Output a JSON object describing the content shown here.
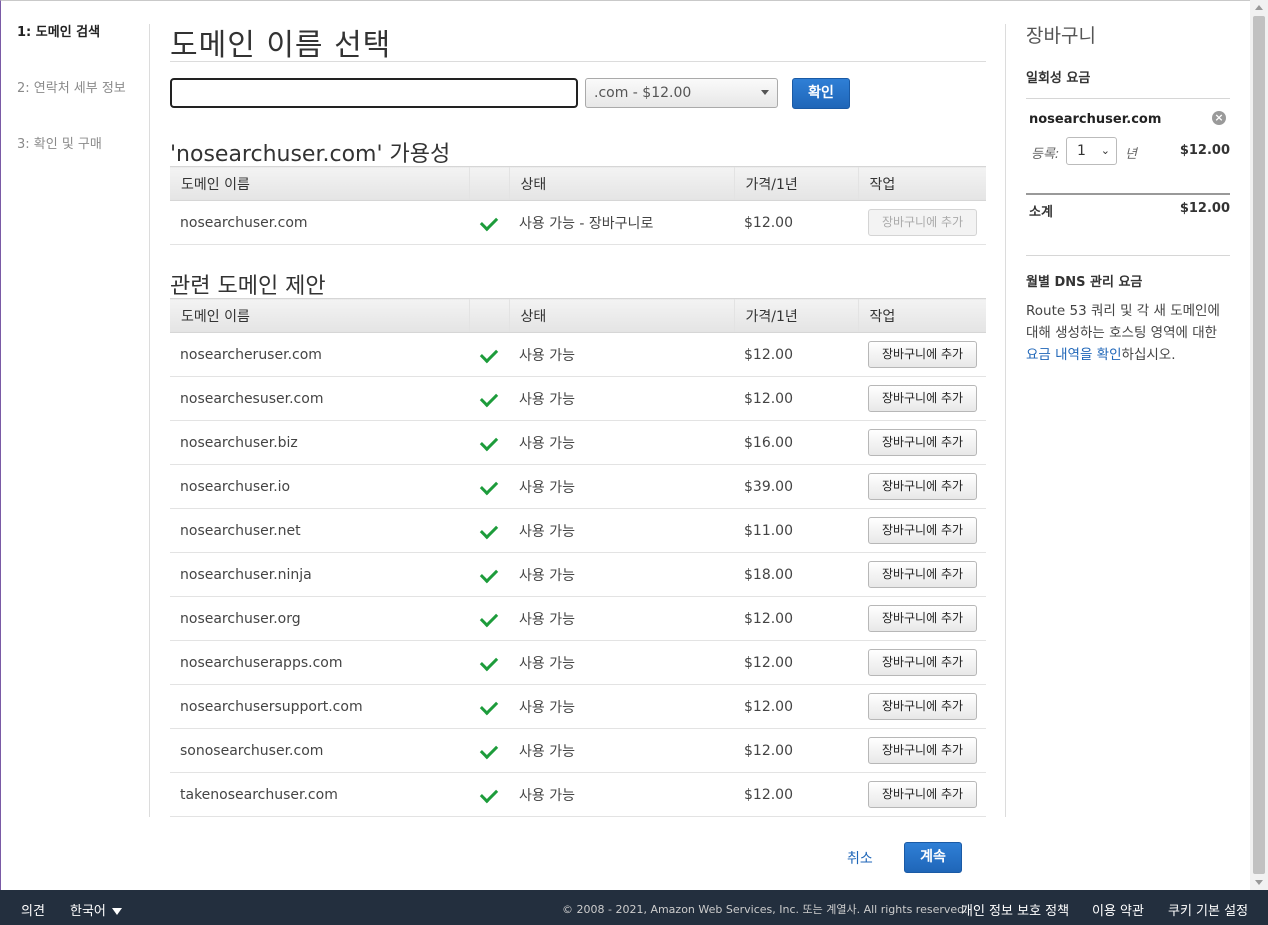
{
  "steps": [
    {
      "label": "1: 도메인 검색"
    },
    {
      "label": "2: 연락처 세부 정보"
    },
    {
      "label": "3: 확인 및 구매"
    }
  ],
  "main": {
    "title": "도메인 이름 선택",
    "search": {
      "value": "",
      "placeholder": ""
    },
    "tld_selected": ".com - $12.00",
    "confirm_label": "확인",
    "availability_title": "'nosearchuser.com' 가용성",
    "related_title": "관련 도메인 제안",
    "columns": [
      "도메인 이름",
      "",
      "상태",
      "가격/1년",
      "작업"
    ],
    "availability_row": {
      "domain": "nosearchuser.com",
      "status": "사용 가능 - 장바구니로",
      "price": "$12.00",
      "action": "장바구니에 추가"
    },
    "related_rows": [
      {
        "domain": "nosearcheruser.com",
        "status": "사용 가능",
        "price": "$12.00",
        "action": "장바구니에 추가"
      },
      {
        "domain": "nosearchesuser.com",
        "status": "사용 가능",
        "price": "$12.00",
        "action": "장바구니에 추가"
      },
      {
        "domain": "nosearchuser.biz",
        "status": "사용 가능",
        "price": "$16.00",
        "action": "장바구니에 추가"
      },
      {
        "domain": "nosearchuser.io",
        "status": "사용 가능",
        "price": "$39.00",
        "action": "장바구니에 추가"
      },
      {
        "domain": "nosearchuser.net",
        "status": "사용 가능",
        "price": "$11.00",
        "action": "장바구니에 추가"
      },
      {
        "domain": "nosearchuser.ninja",
        "status": "사용 가능",
        "price": "$18.00",
        "action": "장바구니에 추가"
      },
      {
        "domain": "nosearchuser.org",
        "status": "사용 가능",
        "price": "$12.00",
        "action": "장바구니에 추가"
      },
      {
        "domain": "nosearchuserapps.com",
        "status": "사용 가능",
        "price": "$12.00",
        "action": "장바구니에 추가"
      },
      {
        "domain": "nosearchusersupport.com",
        "status": "사용 가능",
        "price": "$12.00",
        "action": "장바구니에 추가"
      },
      {
        "domain": "sonosearchuser.com",
        "status": "사용 가능",
        "price": "$12.00",
        "action": "장바구니에 추가"
      },
      {
        "domain": "takenosearchuser.com",
        "status": "사용 가능",
        "price": "$12.00",
        "action": "장바구니에 추가"
      }
    ],
    "cancel_label": "취소",
    "continue_label": "계속"
  },
  "cart": {
    "title": "장바구니",
    "one_time_label": "일회성 요금",
    "item_domain": "nosearchuser.com",
    "register_label": "등록:",
    "years_value": "1",
    "year_unit": "년",
    "item_price": "$12.00",
    "subtotal_label": "소계",
    "subtotal_value": "$12.00",
    "dns_title": "월별 DNS 관리 요금",
    "dns_text_before": "Route 53 쿼리 및 각 새 도메인에 대해 생성하는 호스팅 영역에 대한 ",
    "dns_link": "요금 내역을 확인",
    "dns_text_after": "하십시오."
  },
  "footer": {
    "feedback": "의견",
    "language": "한국어",
    "copyright": "© 2008 - 2021, Amazon Web Services, Inc. 또는 계열사. All rights reserved.",
    "privacy": "개인 정보 보호 정책",
    "terms": "이용 약관",
    "cookies": "쿠키 기본 설정"
  },
  "colors": {
    "accent": "#1f66b8",
    "footer_bg": "#232f3e",
    "check": "#1d9c3b"
  }
}
